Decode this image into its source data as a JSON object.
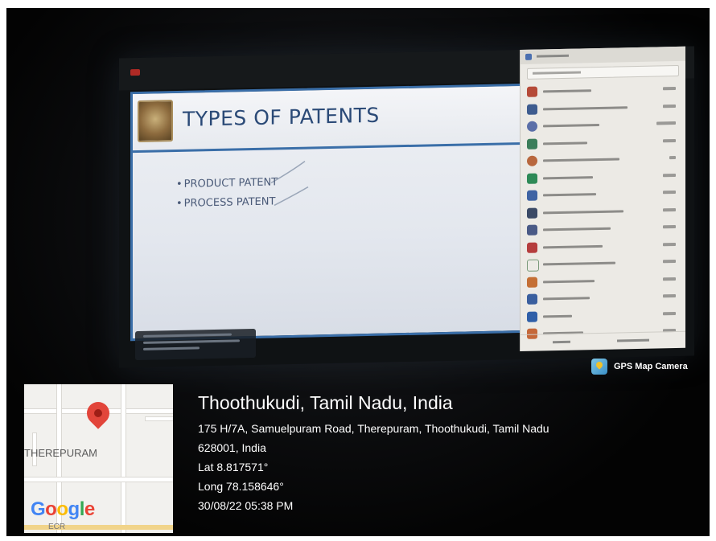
{
  "slide": {
    "title": "TYPES OF PATENTS",
    "bullets": [
      "PRODUCT PATENT",
      "PROCESS PATENT"
    ]
  },
  "badge": {
    "label": "GPS Map Camera"
  },
  "map": {
    "area_label": "THEREPURAM",
    "brand": [
      "G",
      "o",
      "o",
      "g",
      "l",
      "e"
    ],
    "road_label": "ECR"
  },
  "location": {
    "place": "Thoothukudi, Tamil Nadu, India",
    "address_line1": "175 H/7A, Samuelpuram Road, Therepuram, Thoothukudi, Tamil Nadu",
    "address_line2": "628001, India",
    "lat": "Lat 8.817571°",
    "long": "Long 78.158646°",
    "datetime": "30/08/22 05:38 PM"
  },
  "colors": {
    "slide_accent": "#3a6ea8",
    "pin": "#e2453a",
    "text": "#ffffff"
  }
}
